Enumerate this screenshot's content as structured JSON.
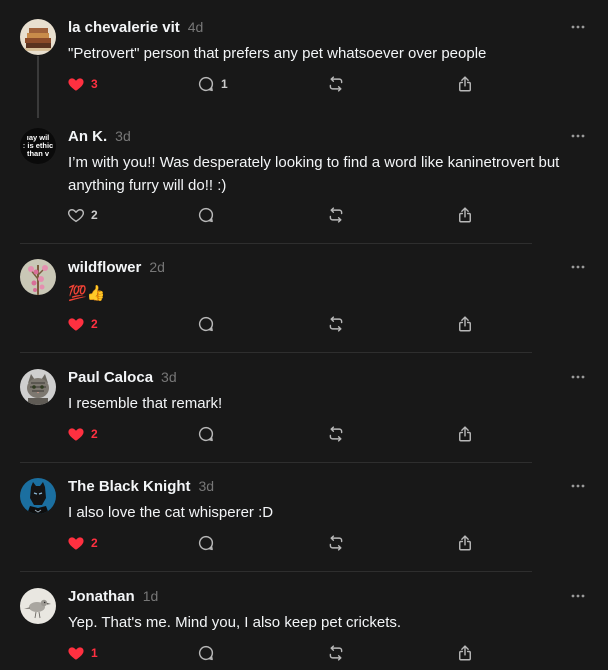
{
  "replies": [
    {
      "username": "la chevalerie vit",
      "time": "4d",
      "text": "\"Petrovert\" person that prefers any pet whatsoever over people",
      "likes": "3",
      "liked": true,
      "comments": "1",
      "avatar": "stack-of-books"
    },
    {
      "username": "An K.",
      "time": "3d",
      "text": "I’m with you!! Was desperately looking to find a word like kaninetrovert but anything furry will do!! :)",
      "likes": "2",
      "liked": false,
      "comments": "",
      "avatar": "text-meme",
      "avatar_text": [
        "ıay wil",
        "ː is ethic",
        "than v"
      ]
    },
    {
      "username": "wildflower",
      "time": "2d",
      "text": "💯👍",
      "likes": "2",
      "liked": true,
      "comments": "",
      "avatar": "pink-blossoms"
    },
    {
      "username": "Paul Caloca",
      "time": "3d",
      "text": "I resemble that remark!",
      "likes": "2",
      "liked": true,
      "comments": "",
      "avatar": "tabby-cat"
    },
    {
      "username": "The Black Knight",
      "time": "3d",
      "text": "I also love the cat whisperer :D",
      "likes": "2",
      "liked": true,
      "comments": "",
      "avatar": "black-panther"
    },
    {
      "username": "Jonathan",
      "time": "1d",
      "text": "Yep. That's me. Mind you, I also keep pet crickets.",
      "likes": "1",
      "liked": true,
      "comments": "",
      "avatar": "bird"
    }
  ],
  "colors": {
    "background": "#181818",
    "text": "#f3f5f7",
    "muted": "#777777",
    "like": "#ff3040",
    "icon": "#b8b8b8"
  }
}
